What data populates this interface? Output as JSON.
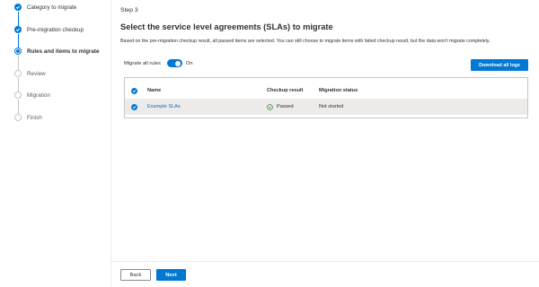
{
  "wizard": {
    "steps": [
      {
        "label": "Category to migrate",
        "state": "done"
      },
      {
        "label": "Pre-migration checkup",
        "state": "done"
      },
      {
        "label": "Rules and items to migrate",
        "state": "current"
      },
      {
        "label": "Review",
        "state": "todo"
      },
      {
        "label": "Migration",
        "state": "todo"
      },
      {
        "label": "Finish",
        "state": "todo"
      }
    ]
  },
  "main": {
    "step_number": "Step 3",
    "title": "Select the service level agreements (SLAs) to migrate",
    "description": "Based on the pre-migration checkup result, all passed items are selected. You can still choose to migrate items with failed checkup result, but the data won't migrate completely.",
    "toggle": {
      "label": "Migrate all rules",
      "state_label": "On",
      "on": true
    },
    "download_button": "Download all logs",
    "table": {
      "columns": [
        "Name",
        "Checkup result",
        "Migration status"
      ],
      "rows": [
        {
          "selected": true,
          "name": "Example SLAs",
          "checkup_result": "Passed",
          "migration_status": "Not started"
        }
      ]
    }
  },
  "footer": {
    "back_label": "Back",
    "next_label": "Next"
  },
  "colors": {
    "accent": "#0078d4",
    "selected_row": "#edebe9",
    "passed": "#107c10"
  }
}
